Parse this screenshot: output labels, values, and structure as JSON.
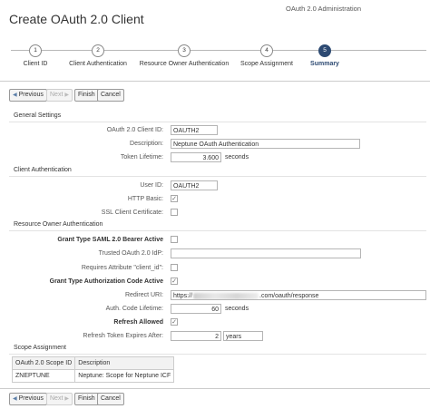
{
  "window": {
    "app_title": "OAuth 2.0 Administration",
    "page_title": "Create OAuth 2.0 Client"
  },
  "wizard": {
    "steps": [
      {
        "number": "1",
        "label": "Client ID"
      },
      {
        "number": "2",
        "label": "Client Authentication"
      },
      {
        "number": "3",
        "label": "Resource Owner Authentication"
      },
      {
        "number": "4",
        "label": "Scope Assignment"
      },
      {
        "number": "5",
        "label": "Summary"
      }
    ],
    "active_step": 5
  },
  "toolbar": {
    "previous": "Previous",
    "next": "Next",
    "finish": "Finish",
    "cancel": "Cancel"
  },
  "general": {
    "heading": "General Settings",
    "client_id_label": "OAuth 2.0 Client ID:",
    "client_id": "OAUTH2",
    "description_label": "Description:",
    "description": "Neptune OAuth Authentication",
    "token_lifetime_label": "Token Lifetime:",
    "token_lifetime": "3.600",
    "token_lifetime_unit": "seconds"
  },
  "client_auth": {
    "heading": "Client Authentication",
    "user_id_label": "User ID:",
    "user_id": "OAUTH2",
    "http_basic_label": "HTTP Basic:",
    "http_basic_checked": true,
    "ssl_cert_label": "SSL Client Certificate:",
    "ssl_cert_checked": false
  },
  "resource_owner": {
    "heading": "Resource Owner Authentication",
    "saml_label": "Grant Type SAML 2.0 Bearer Active",
    "saml_checked": false,
    "idp_label": "Trusted OAuth 2.0 IdP:",
    "idp_value": "",
    "requires_label": "Requires Attribute \"client_id\":",
    "requires_checked": false,
    "authcode_label": "Grant Type Authorization Code Active",
    "authcode_checked": true,
    "redirect_label": "Redirect URI:",
    "redirect_prefix": "https://",
    "redirect_suffix": ".com/oauth/response",
    "auth_code_lifetime_label": "Auth. Code Lifetime:",
    "auth_code_lifetime": "60",
    "auth_code_lifetime_unit": "seconds",
    "refresh_allowed_label": "Refresh Allowed",
    "refresh_allowed_checked": true,
    "refresh_expires_label": "Refresh Token Expires After:",
    "refresh_expires": "2",
    "refresh_expires_unit": "years"
  },
  "scope": {
    "heading": "Scope Assignment",
    "columns": [
      "OAuth 2.0 Scope ID",
      "Description"
    ],
    "rows": [
      [
        "ZNEPTUNE",
        "Neptune: Scope for Neptune ICF"
      ]
    ]
  },
  "icons": {
    "previous": "left-arrow-icon",
    "next": "right-arrow-icon",
    "checkmark": "checkmark-icon"
  }
}
